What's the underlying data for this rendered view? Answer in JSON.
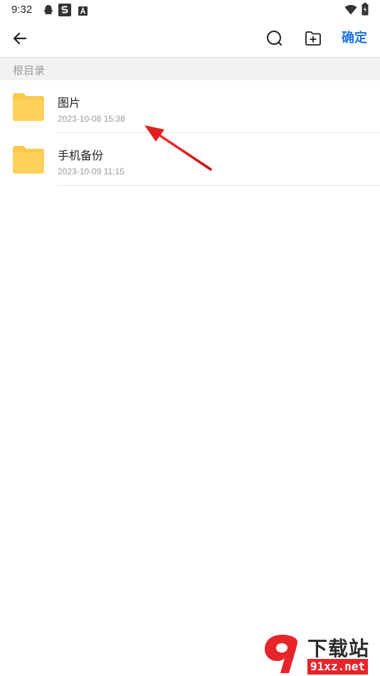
{
  "status_bar": {
    "time": "9:32",
    "icons": [
      "qq-penguin-icon",
      "s-app-icon",
      "a-app-icon",
      "wifi-icon",
      "battery-charging-icon"
    ]
  },
  "app_bar": {
    "back_icon": "arrow-left-icon",
    "search_icon": "search-icon",
    "new_folder_icon": "new-folder-icon",
    "confirm_label": "确定"
  },
  "breadcrumb": {
    "label": "根目录"
  },
  "folders": [
    {
      "name": "图片",
      "date": "2023-10-08 15:38",
      "icon": "folder-icon"
    },
    {
      "name": "手机备份",
      "date": "2023-10-09 11:15",
      "icon": "folder-icon"
    }
  ],
  "annotation": {
    "color": "#e02020"
  },
  "watermark": {
    "title": "下载站",
    "url": "91xz.net"
  },
  "colors": {
    "accent": "#1f74e6",
    "folder": "#fbc94c",
    "breadcrumb_bg": "#f2f2f2"
  }
}
